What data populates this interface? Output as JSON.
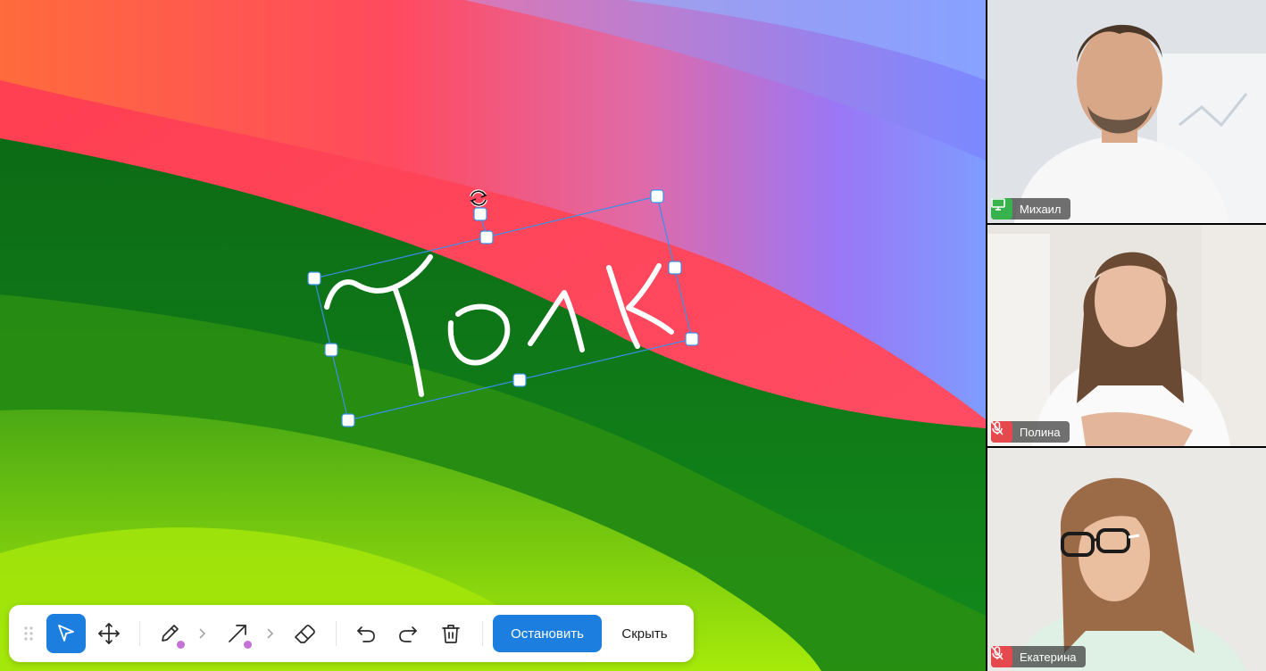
{
  "whiteboard": {
    "annotation_text": "Толк",
    "selection_color": "#3a8fe8"
  },
  "participants": [
    {
      "name": "Михаил",
      "status": "screen-sharing",
      "status_icon": "monitor-icon",
      "status_color": "#37b24d"
    },
    {
      "name": "Полина",
      "status": "muted",
      "status_icon": "mic-off-icon",
      "status_color": "#e5484d"
    },
    {
      "name": "Екатерина",
      "status": "muted",
      "status_icon": "mic-off-icon",
      "status_color": "#e5484d"
    }
  ],
  "toolbar": {
    "tools": [
      {
        "name": "drag-handle-icon"
      },
      {
        "name": "cursor-icon",
        "active": true
      },
      {
        "name": "move-icon"
      },
      {
        "name": "pen-icon",
        "color": "#c471d8"
      },
      {
        "name": "arrow-icon",
        "color": "#c471d8"
      },
      {
        "name": "eraser-icon"
      },
      {
        "name": "undo-icon"
      },
      {
        "name": "redo-icon"
      },
      {
        "name": "trash-icon"
      }
    ],
    "accent": "#1c7fe0",
    "stop_label": "Остановить",
    "hide_label": "Скрыть"
  }
}
